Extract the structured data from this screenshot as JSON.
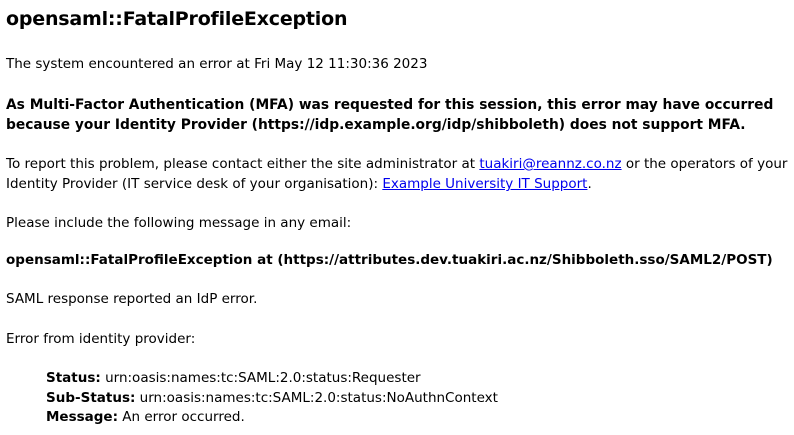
{
  "title": "opensaml::FatalProfileException",
  "error_time_text": "The system encountered an error at Fri May 12 11:30:36 2023",
  "mfa_notice": "As Multi-Factor Authentication (MFA) was requested for this session, this error may have occurred because your Identity Provider (https://idp.example.org/idp/shibboleth) does not support MFA.",
  "report": {
    "text_before": "To report this problem, please contact either the site administrator at ",
    "admin_email": "tuakiri@reannz.co.nz",
    "text_middle": " or the operators of your Identity Provider (IT service desk of your organisation): ",
    "support_link": "Example University IT Support",
    "text_after": "."
  },
  "include_text": "Please include the following message in any email:",
  "exception_message": "opensaml::FatalProfileException at (https://attributes.dev.tuakiri.ac.nz/Shibboleth.sso/SAML2/POST)",
  "saml_response_text": "SAML response reported an IdP error.",
  "error_from_idp_text": "Error from identity provider:",
  "status": {
    "status_label": "Status:",
    "status_value": " urn:oasis:names:tc:SAML:2.0:status:Requester",
    "substatus_label": "Sub-Status:",
    "substatus_value": " urn:oasis:names:tc:SAML:2.0:status:NoAuthnContext",
    "message_label": "Message:",
    "message_value": " An error occurred."
  },
  "colors": {
    "link": "#0000ee",
    "text": "#000000",
    "background": "#ffffff"
  }
}
